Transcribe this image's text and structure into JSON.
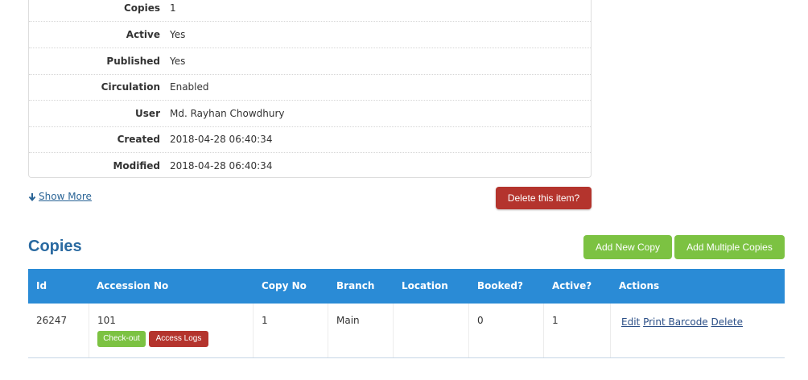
{
  "details": [
    {
      "label": "Copies",
      "value": "1"
    },
    {
      "label": "Active",
      "value": "Yes"
    },
    {
      "label": "Published",
      "value": "Yes"
    },
    {
      "label": "Circulation",
      "value": "Enabled"
    },
    {
      "label": "User",
      "value": "Md. Rayhan Chowdhury"
    },
    {
      "label": "Created",
      "value": "2018-04-28 06:40:34"
    },
    {
      "label": "Modified",
      "value": "2018-04-28 06:40:34"
    }
  ],
  "show_more": "Show More",
  "delete_item_label": "Delete this item?",
  "copies": {
    "title": "Copies",
    "add_new_label": "Add New Copy",
    "add_multiple_label": "Add Multiple Copies",
    "headers": [
      "Id",
      "Accession No",
      "Copy No",
      "Branch",
      "Location",
      "Booked?",
      "Active?",
      "Actions"
    ],
    "rows": [
      {
        "id": "26247",
        "accession_no": "101",
        "copy_no": "1",
        "branch": "Main",
        "location": "",
        "booked": "0",
        "active": "1",
        "checkout_label": "Check-out",
        "logs_label": "Access Logs",
        "actions": [
          "Edit",
          "Print Barcode",
          "Delete"
        ]
      }
    ]
  },
  "colors": {
    "header_blue": "#2a8bd6",
    "green": "#7cc242",
    "red": "#b4342d",
    "title_blue": "#2a6aa1"
  }
}
